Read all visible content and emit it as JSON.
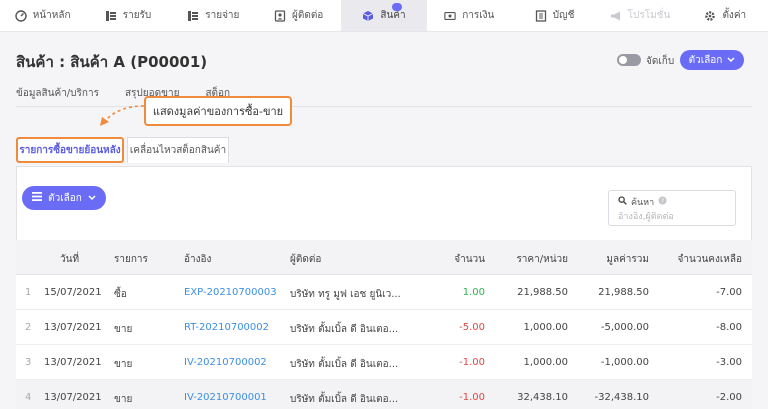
{
  "nav": {
    "items": [
      {
        "label": "หน้าหลัก",
        "icon": "dashboard-icon",
        "state": "normal"
      },
      {
        "label": "รายรับ",
        "icon": "income-icon",
        "state": "normal"
      },
      {
        "label": "รายจ่าย",
        "icon": "expense-icon",
        "state": "normal"
      },
      {
        "label": "ผู้ติดต่อ",
        "icon": "contacts-icon",
        "state": "normal"
      },
      {
        "label": "สินค้า",
        "icon": "box-icon",
        "state": "active"
      },
      {
        "label": "การเงิน",
        "icon": "finance-icon",
        "state": "normal"
      },
      {
        "label": "บัญชี",
        "icon": "ledger-icon",
        "state": "normal"
      },
      {
        "label": "โปรโมชั่น",
        "icon": "megaphone-icon",
        "state": "disabled"
      },
      {
        "label": "ตั้งค่า",
        "icon": "gear-icon",
        "state": "normal"
      }
    ]
  },
  "page": {
    "title": "สินค้า : สินค้า A (P00001)",
    "toggle_label": "จัดเก็บ",
    "options_label": "ตัวเลือก"
  },
  "section_tabs": [
    "ข้อมูลสินค้า/บริการ",
    "สรุปยอดขาย",
    "สต็อก"
  ],
  "callout": {
    "text": "แสดงมูลค่าของการซื้อ-ขาย"
  },
  "subtabs": [
    "รายการซื้อขายย้อนหลัง",
    "เคลื่อนไหวสต็อกสินค้า"
  ],
  "toolbar": {
    "options_label": "ตัวเลือก"
  },
  "search": {
    "label": "ค้นหา",
    "placeholder": "อ้างอิง,ผู้ติดต่อ"
  },
  "table": {
    "headers": {
      "date": "วันที่",
      "type": "รายการ",
      "ref": "อ้างอิง",
      "contact": "ผู้ติดต่อ",
      "qty": "จำนวน",
      "price": "ราคา/หน่วย",
      "total": "มูลค่ารวม",
      "balance": "จำนวนคงเหลือ"
    },
    "rows": [
      {
        "idx": "1",
        "date": "15/07/2021",
        "type": "ซื้อ",
        "ref": "EXP-20210700003",
        "contact": "บริษัท ทรู มูฟ เอช ยูนิเว...",
        "qty": "1.00",
        "price": "21,988.50",
        "total": "21,988.50",
        "balance": "-7.00"
      },
      {
        "idx": "2",
        "date": "13/07/2021",
        "type": "ขาย",
        "ref": "RT-20210700002",
        "contact": "บริษัท ตั้มเบิ้ล ดี อินเตอ...",
        "qty": "-5.00",
        "price": "1,000.00",
        "total": "-5,000.00",
        "balance": "-8.00"
      },
      {
        "idx": "3",
        "date": "13/07/2021",
        "type": "ขาย",
        "ref": "IV-20210700002",
        "contact": "บริษัท ตั้มเบิ้ล ดี อินเตอ...",
        "qty": "-1.00",
        "price": "1,000.00",
        "total": "-1,000.00",
        "balance": "-3.00"
      },
      {
        "idx": "4",
        "date": "13/07/2021",
        "type": "ขาย",
        "ref": "IV-20210700001",
        "contact": "บริษัท ตั้มเบิ้ล ดี อินเตอ...",
        "qty": "-1.00",
        "price": "32,438.10",
        "total": "-32,438.10",
        "balance": "-2.00"
      }
    ]
  },
  "colors": {
    "accent": "#6a6cf6",
    "callout_border": "#f08a3c",
    "link": "#3d8fe0",
    "positive": "#2eb24e",
    "negative": "#e14848"
  }
}
